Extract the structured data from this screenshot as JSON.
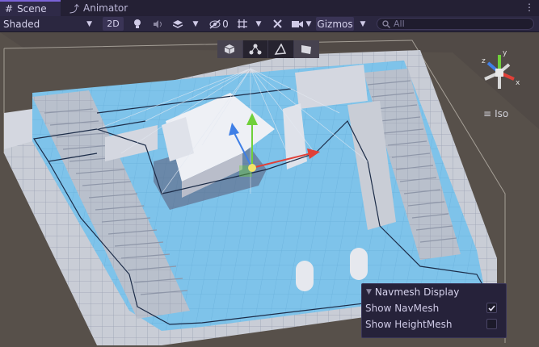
{
  "tabs": [
    {
      "label": "Scene",
      "icon": "grid-icon"
    },
    {
      "label": "Animator",
      "icon": "animator-icon"
    }
  ],
  "toolbar": {
    "draw_mode": "Shaded",
    "mode_2d": "2D",
    "hidden_count": "0",
    "gizmos_label": "Gizmos",
    "search_placeholder": "All"
  },
  "scene_tools": [
    "cube-icon",
    "nodes-icon",
    "path-icon",
    "flag-icon"
  ],
  "orientation": {
    "projection": "Iso",
    "axes": [
      "x",
      "y",
      "z"
    ]
  },
  "navmesh_panel": {
    "title": "Navmesh Display",
    "rows": [
      {
        "label": "Show NavMesh",
        "checked": true
      },
      {
        "label": "Show HeightMesh",
        "checked": false
      }
    ]
  },
  "colors": {
    "accent": "#7a63d8",
    "navmesh": "#7ec3ea",
    "geometry": "#d4d7e0",
    "ground": "#5a5048"
  }
}
